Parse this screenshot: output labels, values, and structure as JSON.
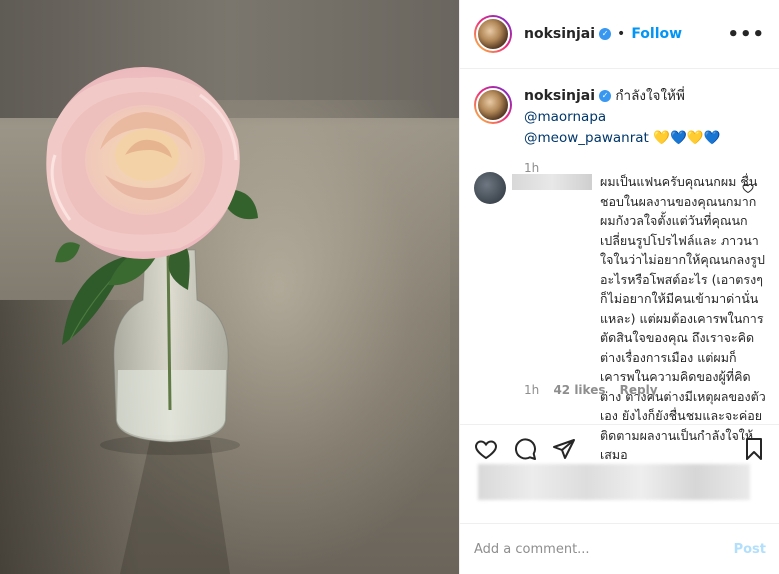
{
  "post": {
    "username": "noksinjai",
    "follow_label": "Follow",
    "dot": "•",
    "more_label": "•••",
    "verified_glyph": "✓",
    "caption": {
      "username": "noksinjai",
      "text": "กำลังใจให้พี่ ",
      "mention1": "@maornapa",
      "mention2": "@meow_pawanrat",
      "emoji": " 💛💙💛💙",
      "time": "1h"
    },
    "comment": {
      "text": "ผมเป็นแฟนครับคุณนกผม ชื่นชอบในผลงานของคุณนกมาก ผมกังวลใจตั้งแต่วันที่คุณนกเปลี่ยนรูปโปรไฟล์และ ภาวนาใจในว่าไม่อยากให้คุณนกลงรูปอะไรหรือโพสต์อะไร (เอาตรงๆก็ไม่อยากให้มีคนเข้ามาด่านั่นแหละ) แต่ผมต้องเคารพในการตัดสินใจของคุณ ถึงเราจะคิดต่างเรื่องการเมือง แต่ผมก็เคารพในความคิดของผู้ที่คิดต่าง ต่างคนต่างมีเหตุผลของตัวเอง ยังไงก็ยังชื่นชมและจะค่อยติดตามผลงานเป็นกำลังใจให้เสมอ",
      "time": "1h",
      "likes": "42 likes",
      "reply": "Reply"
    },
    "add_comment_placeholder": "Add a comment...",
    "post_label": "Post"
  },
  "colors": {
    "accent": "#0095f6",
    "post_disabled": "#b2dffc",
    "mention": "#00376b",
    "meta": "#8e8e8e"
  },
  "icons": [
    "verified-badge-icon",
    "more-options-icon",
    "heart-icon",
    "comment-icon",
    "share-icon",
    "bookmark-icon"
  ]
}
